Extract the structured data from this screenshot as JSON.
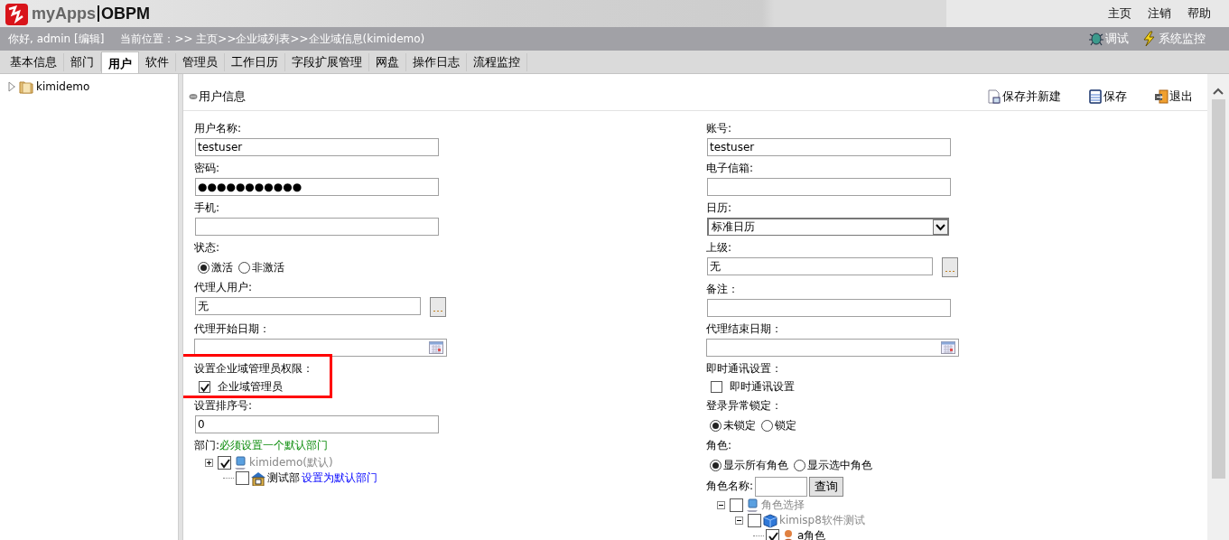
{
  "header": {
    "brand": "myApps",
    "product": "OBPM",
    "links": [
      "主页",
      "注销",
      "帮助"
    ]
  },
  "info_bar": {
    "greeting": "你好, admin [编辑]",
    "location": "当前位置：>> 主页>>企业域列表>>企业域信息(kimidemo)",
    "tools": [
      "调试",
      "系统监控"
    ]
  },
  "tabs": [
    {
      "label": "基本信息",
      "selected": false
    },
    {
      "label": "部门",
      "selected": false
    },
    {
      "label": "用户",
      "selected": true
    },
    {
      "label": "软件",
      "selected": false
    },
    {
      "label": "管理员",
      "selected": false
    },
    {
      "label": "工作日历",
      "selected": false
    },
    {
      "label": "字段扩展管理",
      "selected": false
    },
    {
      "label": "网盘",
      "selected": false
    },
    {
      "label": "操作日志",
      "selected": false
    },
    {
      "label": "流程监控",
      "selected": false
    }
  ],
  "sidebar": {
    "tree": [
      {
        "label": "kimidemo",
        "expanded": false
      }
    ]
  },
  "panel": {
    "title": "用户信息",
    "actions": [
      "保存并新建",
      "保存",
      "退出"
    ]
  },
  "form": {
    "left": [
      {
        "kind": "text",
        "label": "用户名称:",
        "value": "testuser"
      },
      {
        "kind": "text",
        "label": "密码:",
        "value": "●●●●●●●●●●●"
      },
      {
        "kind": "text",
        "label": "手机:"
      },
      {
        "kind": "radio",
        "label": "状态:",
        "options": [
          {
            "label": "激活",
            "selected": true
          },
          {
            "label": "非激活",
            "selected": false
          }
        ]
      },
      {
        "kind": "picker",
        "label": "代理人用户:",
        "value": "无"
      },
      {
        "kind": "date",
        "label": "代理开始日期："
      },
      {
        "kind": "checkbox",
        "label": "设置企业域管理员权限：",
        "highlighted": true,
        "options": [
          {
            "label": "企业域管理员",
            "checked": true
          }
        ]
      },
      {
        "kind": "text",
        "label": "设置排序号:",
        "value": "0"
      },
      {
        "kind": "tree",
        "label": "部门:",
        "hint": "必须设置一个默认部门",
        "nodes": [
          {
            "label": "kimidemo(默认)",
            "checked": true,
            "expanded": false,
            "children": [
              {
                "label": "测试部",
                "checked": false,
                "link": "设置为默认部门"
              }
            ]
          }
        ]
      }
    ],
    "right": [
      {
        "kind": "text",
        "label": "账号:",
        "value": "testuser"
      },
      {
        "kind": "text",
        "label": "电子信箱:"
      },
      {
        "kind": "select",
        "label": "日历:",
        "value": "标准日历"
      },
      {
        "kind": "picker",
        "label": "上级:",
        "value": "无"
      },
      {
        "kind": "text",
        "label": "备注："
      },
      {
        "kind": "date",
        "label": "代理结束日期："
      },
      {
        "kind": "checkbox",
        "label": "即时通讯设置：",
        "options": [
          {
            "label": "即时通讯设置",
            "checked": false
          }
        ]
      },
      {
        "kind": "radio",
        "label": "登录异常锁定：",
        "options": [
          {
            "label": "未锁定",
            "selected": true
          },
          {
            "label": "锁定",
            "selected": false
          }
        ]
      },
      {
        "kind": "radio",
        "label": "角色:",
        "options": [
          {
            "label": "显示所有角色",
            "selected": true
          },
          {
            "label": "显示选中角色",
            "selected": false
          }
        ]
      },
      {
        "kind": "search",
        "label": "角色名称:",
        "button": "查询"
      },
      {
        "kind": "tree",
        "nodes": [
          {
            "label": "角色选择",
            "checked": false,
            "expanded": true,
            "children": [
              {
                "label": "kimisp8软件测试",
                "checked": false,
                "expanded": true,
                "children": [
                  {
                    "label": "a角色",
                    "checked": true
                  }
                ]
              }
            ]
          }
        ]
      }
    ]
  }
}
